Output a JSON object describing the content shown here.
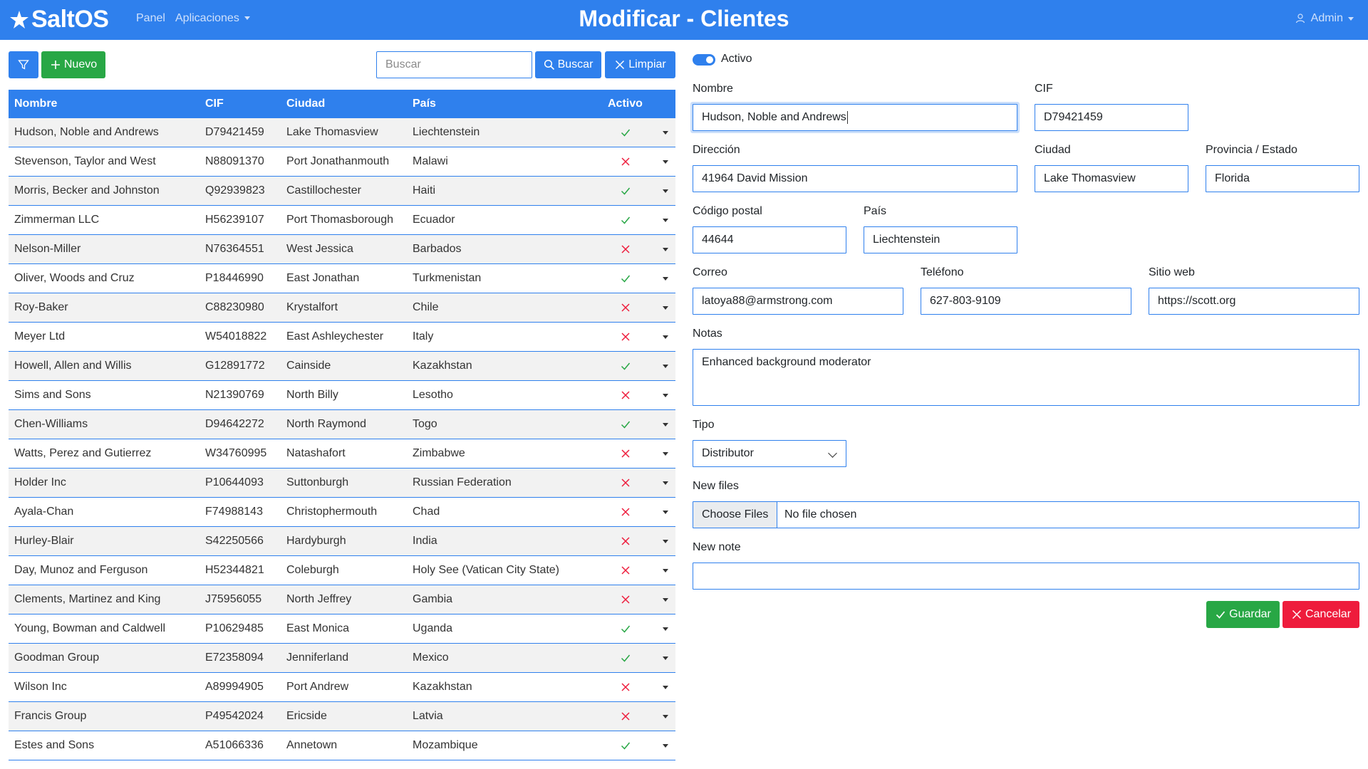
{
  "header": {
    "brand": "SaltOS",
    "nav_panel": "Panel",
    "nav_apps": "Aplicaciones",
    "title": "Modificar - Clientes",
    "user": "Admin",
    "color": "#2f80ed"
  },
  "toolbar": {
    "new_label": "Nuevo",
    "search_placeholder": "Buscar",
    "search_label": "Buscar",
    "clear_label": "Limpiar"
  },
  "table": {
    "columns": [
      "Nombre",
      "CIF",
      "Ciudad",
      "País",
      "Activo"
    ],
    "rows": [
      {
        "name": "Hudson, Noble and Andrews",
        "cif": "D79421459",
        "city": "Lake Thomasview",
        "country": "Liechtenstein",
        "active": true
      },
      {
        "name": "Stevenson, Taylor and West",
        "cif": "N88091370",
        "city": "Port Jonathanmouth",
        "country": "Malawi",
        "active": false
      },
      {
        "name": "Morris, Becker and Johnston",
        "cif": "Q92939823",
        "city": "Castillochester",
        "country": "Haiti",
        "active": true
      },
      {
        "name": "Zimmerman LLC",
        "cif": "H56239107",
        "city": "Port Thomasborough",
        "country": "Ecuador",
        "active": true
      },
      {
        "name": "Nelson-Miller",
        "cif": "N76364551",
        "city": "West Jessica",
        "country": "Barbados",
        "active": false
      },
      {
        "name": "Oliver, Woods and Cruz",
        "cif": "P18446990",
        "city": "East Jonathan",
        "country": "Turkmenistan",
        "active": true
      },
      {
        "name": "Roy-Baker",
        "cif": "C88230980",
        "city": "Krystalfort",
        "country": "Chile",
        "active": false
      },
      {
        "name": "Meyer Ltd",
        "cif": "W54018822",
        "city": "East Ashleychester",
        "country": "Italy",
        "active": false
      },
      {
        "name": "Howell, Allen and Willis",
        "cif": "G12891772",
        "city": "Cainside",
        "country": "Kazakhstan",
        "active": true
      },
      {
        "name": "Sims and Sons",
        "cif": "N21390769",
        "city": "North Billy",
        "country": "Lesotho",
        "active": false
      },
      {
        "name": "Chen-Williams",
        "cif": "D94642272",
        "city": "North Raymond",
        "country": "Togo",
        "active": true
      },
      {
        "name": "Watts, Perez and Gutierrez",
        "cif": "W34760995",
        "city": "Natashafort",
        "country": "Zimbabwe",
        "active": false
      },
      {
        "name": "Holder Inc",
        "cif": "P10644093",
        "city": "Suttonburgh",
        "country": "Russian Federation",
        "active": false
      },
      {
        "name": "Ayala-Chan",
        "cif": "F74988143",
        "city": "Christophermouth",
        "country": "Chad",
        "active": false
      },
      {
        "name": "Hurley-Blair",
        "cif": "S42250566",
        "city": "Hardyburgh",
        "country": "India",
        "active": false
      },
      {
        "name": "Day, Munoz and Ferguson",
        "cif": "H52344821",
        "city": "Coleburgh",
        "country": "Holy See (Vatican City State)",
        "active": false
      },
      {
        "name": "Clements, Martinez and King",
        "cif": "J75956055",
        "city": "North Jeffrey",
        "country": "Gambia",
        "active": false
      },
      {
        "name": "Young, Bowman and Caldwell",
        "cif": "P10629485",
        "city": "East Monica",
        "country": "Uganda",
        "active": true
      },
      {
        "name": "Goodman Group",
        "cif": "E72358094",
        "city": "Jenniferland",
        "country": "Mexico",
        "active": true
      },
      {
        "name": "Wilson Inc",
        "cif": "A89994905",
        "city": "Port Andrew",
        "country": "Kazakhstan",
        "active": false
      },
      {
        "name": "Francis Group",
        "cif": "P49542024",
        "city": "Ericside",
        "country": "Latvia",
        "active": false
      },
      {
        "name": "Estes and Sons",
        "cif": "A51066336",
        "city": "Annetown",
        "country": "Mozambique",
        "active": true
      }
    ]
  },
  "form": {
    "active_label": "Activo",
    "active_value": true,
    "nombre_label": "Nombre",
    "nombre_value": "Hudson, Noble and Andrews",
    "cif_label": "CIF",
    "cif_value": "D79421459",
    "direccion_label": "Dirección",
    "direccion_value": "41964 David Mission",
    "ciudad_label": "Ciudad",
    "ciudad_value": "Lake Thomasview",
    "provincia_label": "Provincia / Estado",
    "provincia_value": "Florida",
    "cp_label": "Código postal",
    "cp_value": "44644",
    "pais_label": "País",
    "pais_value": "Liechtenstein",
    "correo_label": "Correo",
    "correo_value": "latoya88@armstrong.com",
    "telefono_label": "Teléfono",
    "telefono_value": "627-803-9109",
    "web_label": "Sitio web",
    "web_value": "https://scott.org",
    "notas_label": "Notas",
    "notas_value": "Enhanced background moderator",
    "tipo_label": "Tipo",
    "tipo_value": "Distributor",
    "files_label": "New files",
    "files_button": "Choose Files",
    "files_status": "No file chosen",
    "note_label": "New note",
    "note_value": "",
    "save_label": "Guardar",
    "cancel_label": "Cancelar"
  },
  "colors": {
    "accent": "#2f80ed",
    "success": "#28a745",
    "danger": "#ee1c3c"
  }
}
